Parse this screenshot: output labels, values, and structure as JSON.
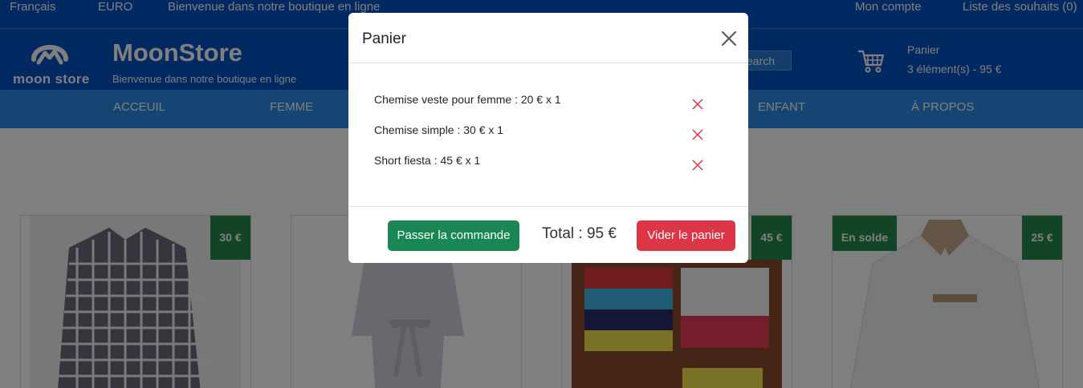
{
  "topbar": {
    "language": "Français",
    "currency": "EURO",
    "welcome": "Bienvenue dans notre boutique en ligne",
    "account": "Mon compte",
    "wishlist": "Liste des souhaits (0)"
  },
  "header": {
    "logo_text": "moon store",
    "brand": "MoonStore",
    "tagline": "Bienvenue dans notre boutique en ligne",
    "search_label": "earch",
    "cart_label": "Panier",
    "cart_summary": "3 élément(s) - 95 €"
  },
  "nav": {
    "items": [
      "ACCEUIL",
      "FEMME",
      "ENFANT",
      "À PROPOS"
    ]
  },
  "products": [
    {
      "price": "30 €",
      "sale": ""
    },
    {
      "price": "",
      "sale": ""
    },
    {
      "price": "45 €",
      "sale": ""
    },
    {
      "price": "25 €",
      "sale": "En solde"
    }
  ],
  "modal": {
    "title": "Panier",
    "items": [
      "Chemise veste pour femme : 20 € x 1",
      "Chemise simple : 30 € x 1",
      "Short fiesta : 45 € x 1"
    ],
    "order_button": "Passer la commande",
    "total": "Total : 95 €",
    "empty_button": "Vider le panier"
  },
  "colors": {
    "primary_blue": "#0052c2",
    "nav_blue": "#2a8ae6",
    "success": "#198754",
    "danger": "#dc3545"
  }
}
